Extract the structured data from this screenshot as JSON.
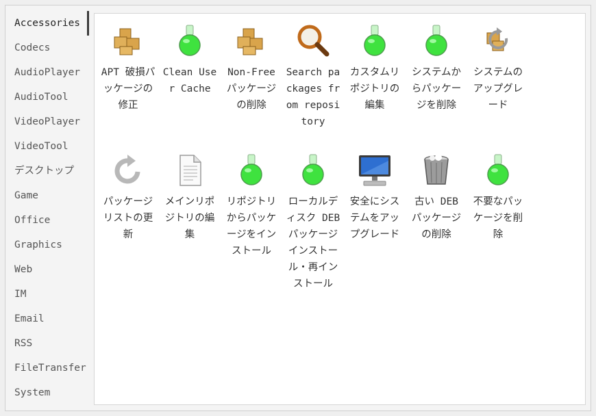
{
  "sidebar": {
    "categories": [
      "Accessories",
      "Codecs",
      "AudioPlayer",
      "AudioTool",
      "VideoPlayer",
      "VideoTool",
      "デスクトップ",
      "Game",
      "Office",
      "Graphics",
      "Web",
      "IM",
      "Email",
      "RSS",
      "FileTransfer",
      "System"
    ],
    "active": "Accessories"
  },
  "items": [
    {
      "label": "APT 破損パッケージの修正",
      "icon": "package-boxes-icon"
    },
    {
      "label": "Clean User Cache",
      "icon": "green-flask-icon"
    },
    {
      "label": "Non-Free パッケージの削除",
      "icon": "package-boxes-icon"
    },
    {
      "label": "Search packages from repository",
      "icon": "magnifier-icon"
    },
    {
      "label": "カスタムリポジトリの編集",
      "icon": "green-flask-icon"
    },
    {
      "label": "システムからパッケージを削除",
      "icon": "green-flask-icon"
    },
    {
      "label": "システムのアップグレード",
      "icon": "package-refresh-icon"
    },
    {
      "label": "パッケージリストの更新",
      "icon": "refresh-icon"
    },
    {
      "label": "メインリポジトリの編集",
      "icon": "document-icon"
    },
    {
      "label": "リポジトリからパッケージをインストール",
      "icon": "green-flask-icon"
    },
    {
      "label": "ローカルディスク DEB パッケージ インストール・再インストール",
      "icon": "green-flask-icon"
    },
    {
      "label": "安全にシステムをアップグレード",
      "icon": "monitor-icon"
    },
    {
      "label": "古い DEB パッケージの削除",
      "icon": "trash-icon"
    },
    {
      "label": "不要なパッケージを削除",
      "icon": "green-flask-icon"
    }
  ]
}
